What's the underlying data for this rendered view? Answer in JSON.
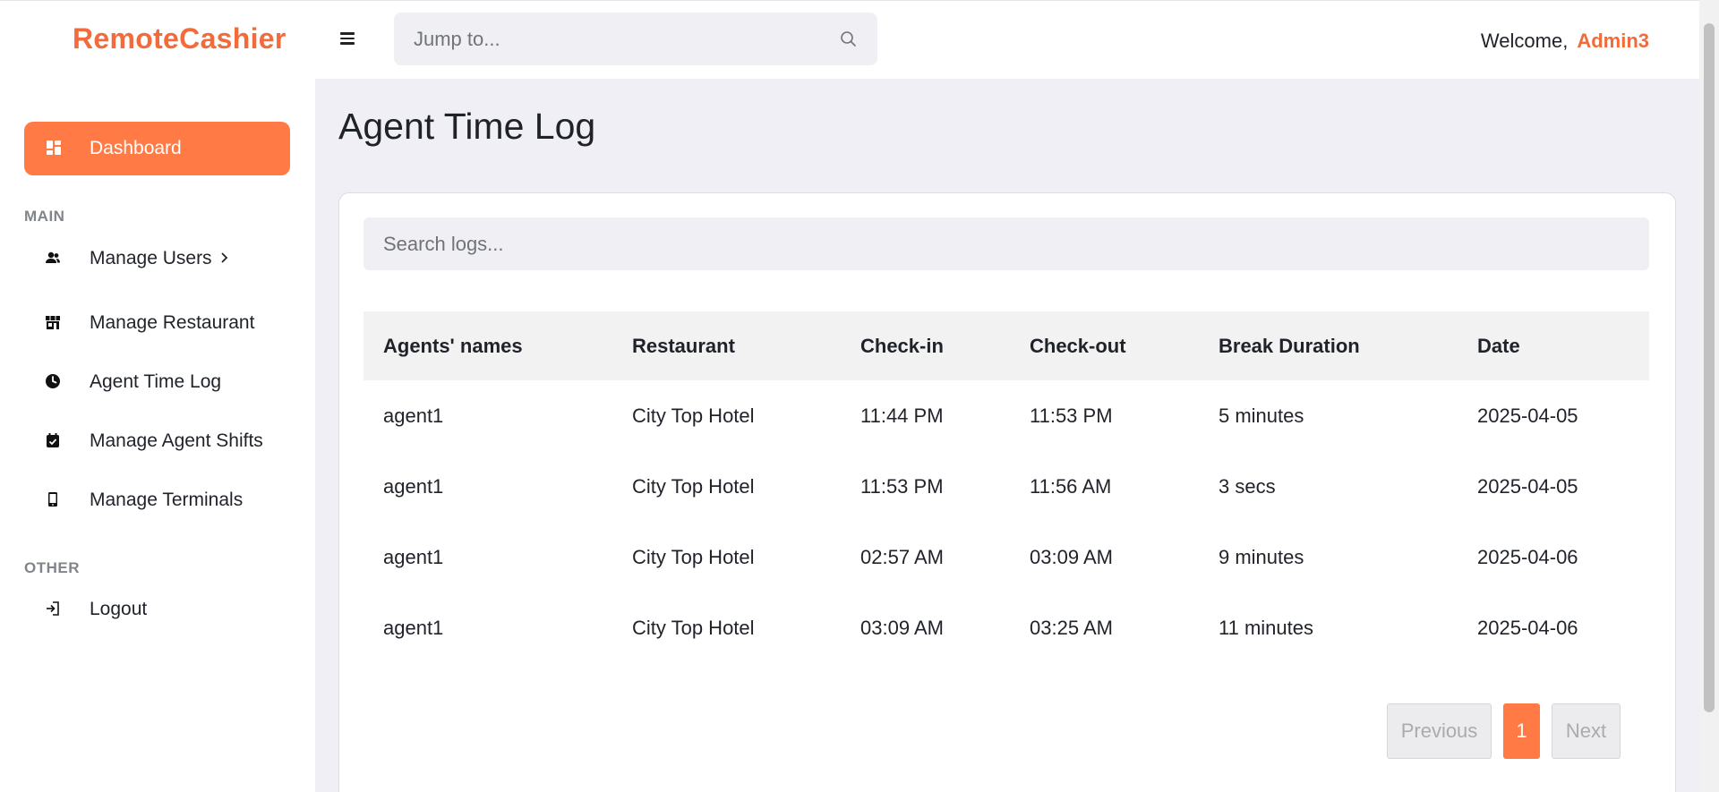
{
  "header": {
    "brand": "RemoteCashier",
    "jump_placeholder": "Jump to...",
    "welcome": "Welcome,",
    "user": "Admin3"
  },
  "sidebar": {
    "active": {
      "label": "Dashboard",
      "icon": "dashboard-grid-icon"
    },
    "main_label": "MAIN",
    "items": [
      {
        "label": "Manage Users",
        "icon": "users-icon",
        "has_chevron": true
      },
      {
        "label": "Manage Restaurant",
        "icon": "store-icon"
      },
      {
        "label": "Agent Time Log",
        "icon": "clock-icon"
      },
      {
        "label": "Manage Agent Shifts",
        "icon": "calendar-check-icon"
      },
      {
        "label": "Manage Terminals",
        "icon": "phone-icon"
      }
    ],
    "other_label": "OTHER",
    "logout": {
      "label": "Logout",
      "icon": "logout-icon"
    }
  },
  "page": {
    "title": "Agent Time Log",
    "search_placeholder": "Search logs..."
  },
  "table": {
    "columns": [
      "Agents' names",
      "Restaurant",
      "Check-in",
      "Check-out",
      "Break Duration",
      "Date"
    ],
    "rows": [
      [
        "agent1",
        "City Top Hotel",
        "11:44 PM",
        "11:53 PM",
        "5 minutes",
        "2025-04-05"
      ],
      [
        "agent1",
        "City Top Hotel",
        "11:53 PM",
        "11:56 AM",
        "3 secs",
        "2025-04-05"
      ],
      [
        "agent1",
        "City Top Hotel",
        "02:57 AM",
        "03:09 AM",
        "9 minutes",
        "2025-04-06"
      ],
      [
        "agent1",
        "City Top Hotel",
        "03:09 AM",
        "03:25 AM",
        "11 minutes",
        "2025-04-06"
      ]
    ]
  },
  "pagination": {
    "previous": "Previous",
    "current": "1",
    "next": "Next"
  },
  "colors": {
    "accent": "#ff7a45",
    "brand": "#f26b3a",
    "main_bg": "#f0eff5"
  }
}
